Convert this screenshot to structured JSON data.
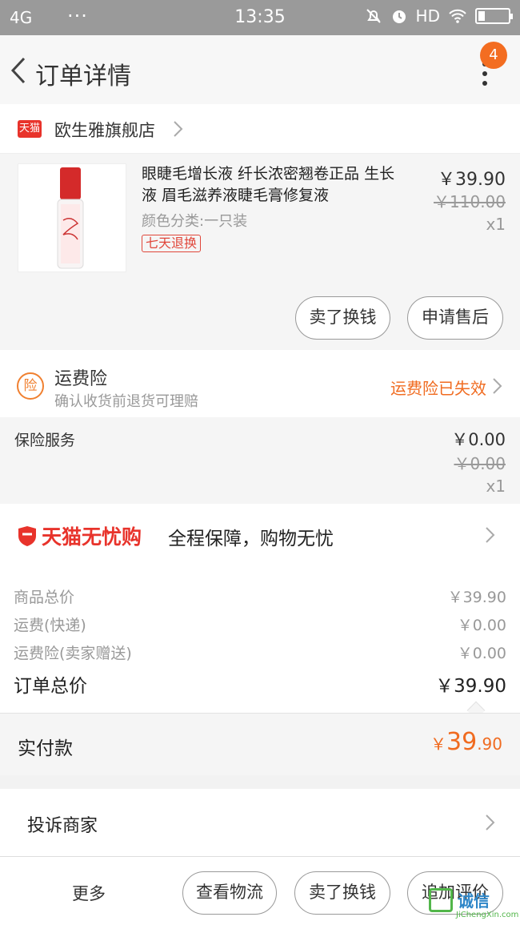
{
  "status_bar": {
    "signal": "4G",
    "time": "13:35",
    "hd": "HD"
  },
  "nav": {
    "title": "订单详情",
    "badge_count": "4"
  },
  "store": {
    "logo": "天猫",
    "name": "欧生雅旗舰店"
  },
  "product": {
    "title": "眼睫毛增长液 纤长浓密翘卷正品 生长液 眉毛滋养液睫毛膏修复液",
    "spec": "颜色分类:一只装",
    "tag": "七天退换",
    "price": "￥39.90",
    "orig_price": "￥110.00",
    "qty": "x1",
    "btn_sell": "卖了换钱",
    "btn_after_sale": "申请售后"
  },
  "insurance": {
    "icon_char": "险",
    "title": "运费险",
    "subtitle": "确认收货前退货可理赔",
    "status": "运费险已失效"
  },
  "service": {
    "label": "保险服务",
    "price": "￥0.00",
    "orig_price": "￥0.00",
    "qty": "x1"
  },
  "guarantee": {
    "brand": "天猫无忧购",
    "text": "全程保障，购物无忧"
  },
  "summary": {
    "rows": [
      {
        "label": "商品总价",
        "value": "￥39.90"
      },
      {
        "label": "运费(快递)",
        "value": "￥0.00"
      },
      {
        "label": "运费险(卖家赠送)",
        "value": "￥0.00"
      }
    ],
    "total_label": "订单总价",
    "total_value": "￥39.90"
  },
  "paid": {
    "label": "实付款",
    "currency": "￥",
    "integer": "39",
    "decimal": ".90"
  },
  "complain": {
    "label": "投诉商家"
  },
  "bottom": {
    "more": "更多",
    "btn_logistics": "查看物流",
    "btn_sell": "卖了换钱",
    "btn_review": "追加评价"
  },
  "watermark": {
    "text": "诚信",
    "url": "JiChengXin.com"
  }
}
